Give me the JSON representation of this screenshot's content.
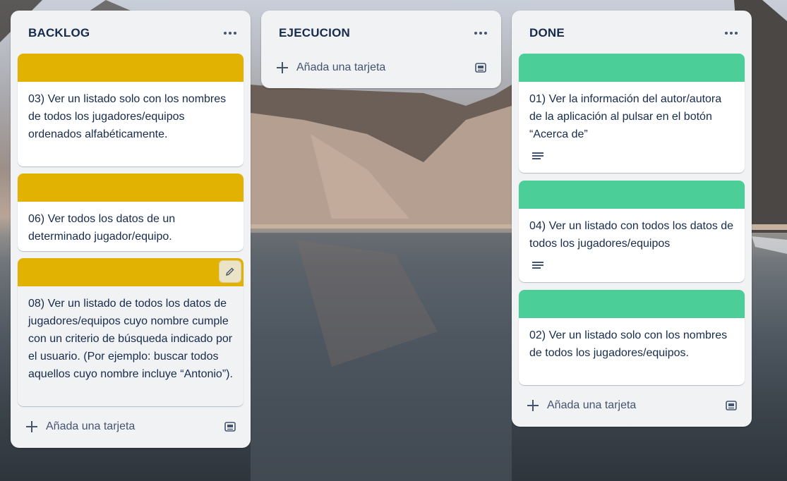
{
  "colors": {
    "label_yellow": "#e2b203",
    "label_green": "#4bce97",
    "list_bg": "#f1f2f4",
    "card_bg": "#ffffff",
    "text_primary": "#172b4d",
    "text_subtle": "#44546f"
  },
  "lists": [
    {
      "title": "BACKLOG",
      "add_card_label": "Añada una tarjeta",
      "cards": [
        {
          "label_color": "yellow",
          "text": "03) Ver un listado solo con los nombres de todos los jugadores/equipos ordenados alfabéticamente."
        },
        {
          "label_color": "yellow",
          "text": "06) Ver todos los datos de un determinado jugador/equipo."
        },
        {
          "label_color": "yellow",
          "text": "08) Ver un listado de todos los datos de jugadores/equipos cuyo nombre cumple con un criterio de búsqueda indicado por el usuario. (Por ejemplo: buscar todos aquellos cuyo nombre incluye “Antonio”).",
          "hovered": true
        }
      ]
    },
    {
      "title": "EJECUCION",
      "add_card_label": "Añada una tarjeta",
      "cards": []
    },
    {
      "title": "DONE",
      "add_card_label": "Añada una tarjeta",
      "cards": [
        {
          "label_color": "green",
          "text": "01) Ver la información del autor/autora de la aplicación al pulsar en el botón “Acerca de”",
          "has_description": true
        },
        {
          "label_color": "green",
          "text": "04) Ver un listado con todos los datos de todos los jugadores/equipos",
          "has_description": true
        },
        {
          "label_color": "green",
          "text": "02) Ver un listado solo con los nombres de todos los jugadores/equipos."
        }
      ]
    }
  ],
  "icons": {
    "list_menu": "ellipsis-icon",
    "add": "plus-icon",
    "template": "card-template-icon",
    "description": "description-icon",
    "edit": "pencil-icon"
  }
}
